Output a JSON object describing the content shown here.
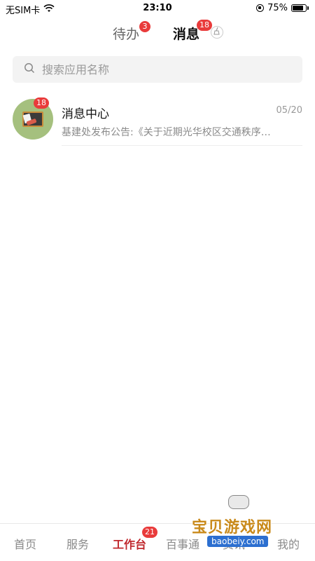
{
  "status_bar": {
    "carrier": "无SIM卡",
    "time": "23:10",
    "battery": "75%",
    "battery_level": 0.75,
    "icons": [
      "wifi-icon",
      "orientation-lock-icon",
      "battery-icon"
    ]
  },
  "top_tabs": [
    {
      "label": "待办",
      "badge": "3",
      "active": false
    },
    {
      "label": "消息",
      "badge": "18",
      "active": true
    }
  ],
  "clear_icon": "broom-icon",
  "search": {
    "placeholder": "搜索应用名称",
    "icon": "search-icon"
  },
  "messages": [
    {
      "title": "消息中心",
      "date": "05/20",
      "preview": "基建处发布公告:《关于近期光华校区交通秩序…",
      "badge": "18",
      "avatar_icon": "announcement-board-icon"
    }
  ],
  "bottom_nav": [
    {
      "label": "首页",
      "active": false
    },
    {
      "label": "服务",
      "active": false
    },
    {
      "label": "工作台",
      "active": true,
      "badge": "21"
    },
    {
      "label": "百事通",
      "active": false
    },
    {
      "label": "资讯",
      "active": false
    },
    {
      "label": "我的",
      "active": false
    }
  ],
  "watermark": {
    "text": "宝贝游戏网",
    "url": "baobeiy.com"
  },
  "colors": {
    "accent": "#c0282d",
    "badge": "#e93b3b",
    "search_bg": "#f3f3f3",
    "muted": "#8a8a8a"
  }
}
